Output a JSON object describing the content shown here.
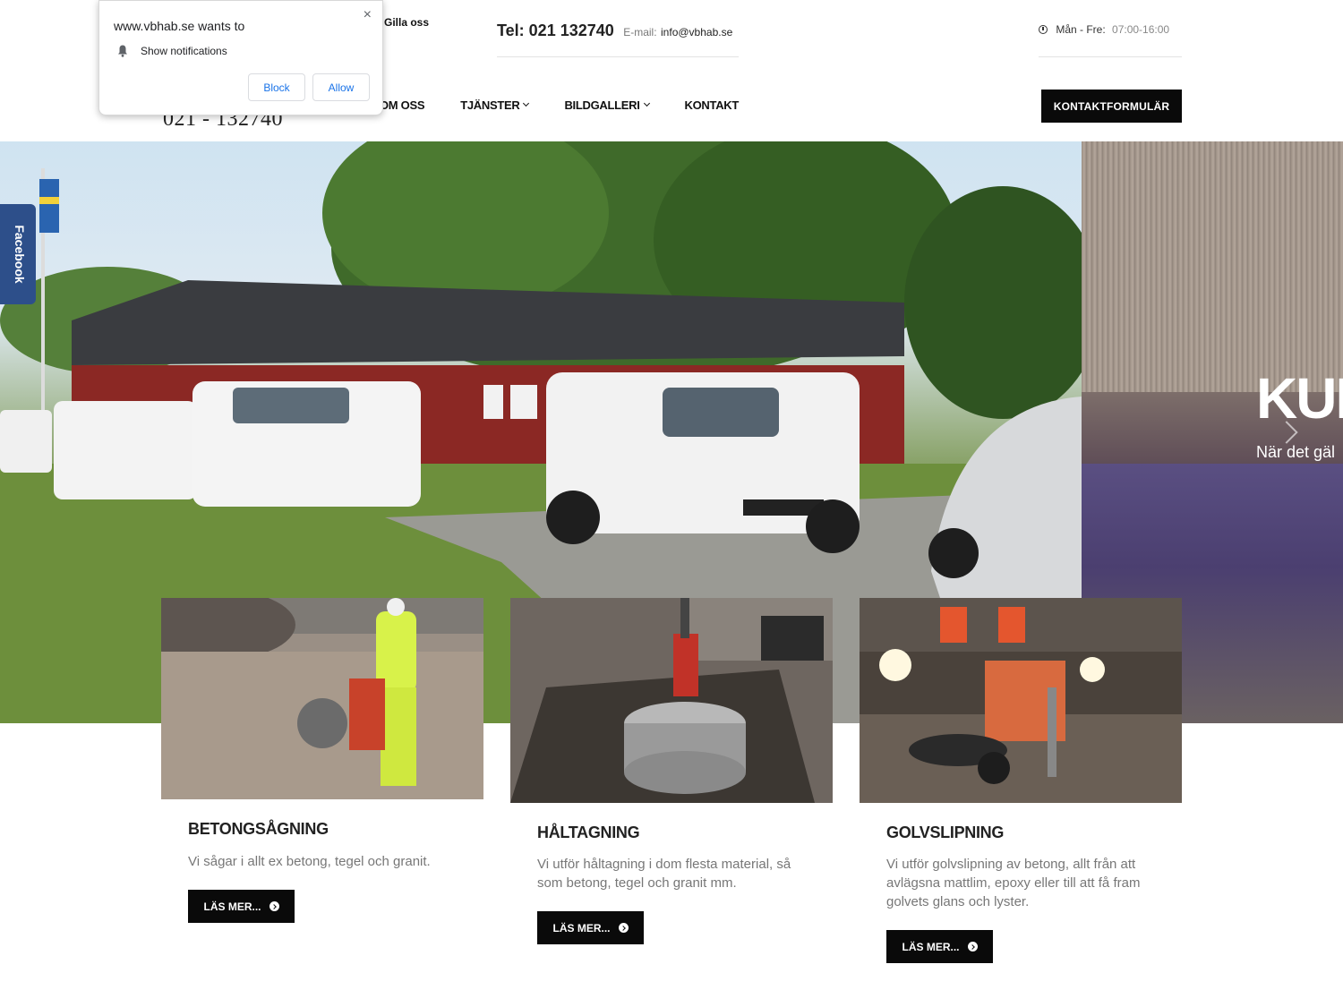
{
  "notification": {
    "title": "www.vbhab.se wants to",
    "message": "Show notifications",
    "block_label": "Block",
    "allow_label": "Allow",
    "close_glyph": "×"
  },
  "header": {
    "facebook_like": "Gilla oss",
    "phone_big": "021 - 132740",
    "tel": "Tel: 021 132740",
    "email_label": "E-mail:",
    "email": "info@vbhab.se",
    "hours_day": "Mån - Fre:",
    "hours_time": "07:00-16:00",
    "cta_label": "KONTAKTFORMULÄR"
  },
  "nav": {
    "items": [
      {
        "label": "OM OSS",
        "dropdown": false
      },
      {
        "label": "TJÄNSTER",
        "dropdown": true
      },
      {
        "label": "BILDGALLERI",
        "dropdown": true
      },
      {
        "label": "KONTAKT",
        "dropdown": false
      }
    ]
  },
  "facebook_tab": "Facebook",
  "hero": {
    "heading": "KUN",
    "subheading": "När det gäl"
  },
  "services": [
    {
      "title": "BETONGSÅGNING",
      "text": "Vi sågar i allt ex betong, tegel och granit.",
      "button": "LÄS MER..."
    },
    {
      "title": "HÅLTAGNING",
      "text": "Vi utför håltagning i dom flesta material, så som betong, tegel och granit mm.",
      "button": "LÄS MER..."
    },
    {
      "title": "GOLVSLIPNING",
      "text": "Vi utför golvslipning av betong, allt från att avlägsna mattlim, epoxy eller till att få fram golvets glans och lyster.",
      "button": "LÄS MER..."
    }
  ],
  "colors": {
    "button_bg": "#0a0a0a",
    "facebook_blue": "#2d4f8a",
    "link_blue": "#1a73e8"
  }
}
